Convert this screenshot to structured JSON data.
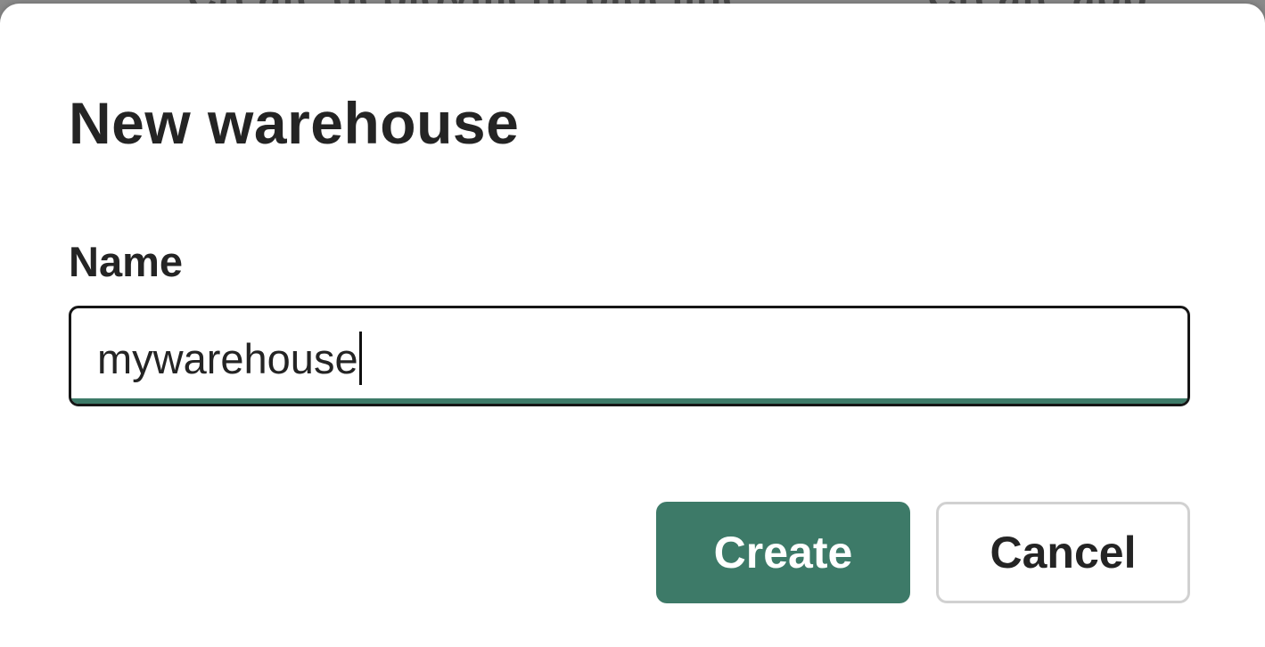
{
  "background": {
    "partial_text_left": "Create deployment pipeline",
    "partial_text_right": "Create app"
  },
  "dialog": {
    "title": "New warehouse",
    "name_label": "Name",
    "name_value": "mywarehouse",
    "create_label": "Create",
    "cancel_label": "Cancel"
  },
  "colors": {
    "accent": "#3d7a68",
    "text": "#242424",
    "border": "#161616",
    "secondary_border": "#d1d1d1"
  }
}
